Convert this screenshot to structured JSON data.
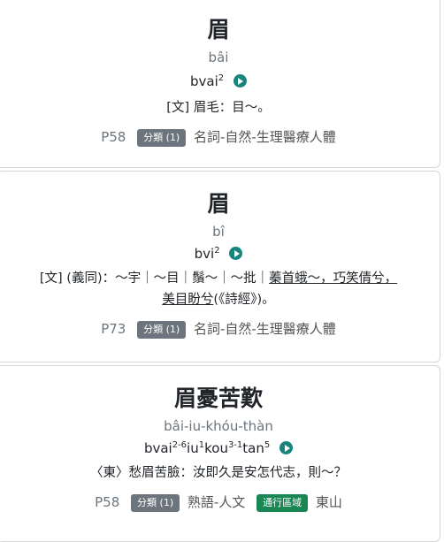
{
  "entries": [
    {
      "headword": "眉",
      "pron": "bâi",
      "roman_base": "bvai",
      "roman_tone": "2",
      "def_tag": "[文]",
      "def_text": "眉毛：目～。",
      "page": "P58",
      "cat_badge": "分類 (1)",
      "category": "名詞-自然-生理醫療人體"
    },
    {
      "headword": "眉",
      "pron": "bî",
      "roman_base": "bvi",
      "roman_tone": "2",
      "def_tag": "[文]",
      "def_prefix": "(義同)：～宇｜～目｜鬚～｜～批｜",
      "def_underlined_1": "蓁首蛾～，巧笑倩兮，",
      "def_underlined_2": "美目盼兮",
      "def_source": "(《詩經》)。",
      "page": "P73",
      "cat_badge": "分類 (1)",
      "category": "名詞-自然-生理醫療人體"
    },
    {
      "headword": "眉憂苦歎",
      "pron": "bâi-iu-khóu-thàn",
      "roman_parts": [
        {
          "base": "bvai",
          "tone": "2-6"
        },
        {
          "base": "iu",
          "tone": "1"
        },
        {
          "base": "kou",
          "tone": "3-1"
        },
        {
          "base": "tan",
          "tone": "5"
        }
      ],
      "def_text": "〈東〉愁眉苦臉：汝即久是安怎代志，則～？",
      "page": "P58",
      "cat_badge": "分類 (1)",
      "category": "熟語-人文",
      "region_badge": "通行區域",
      "region": "東山"
    }
  ]
}
